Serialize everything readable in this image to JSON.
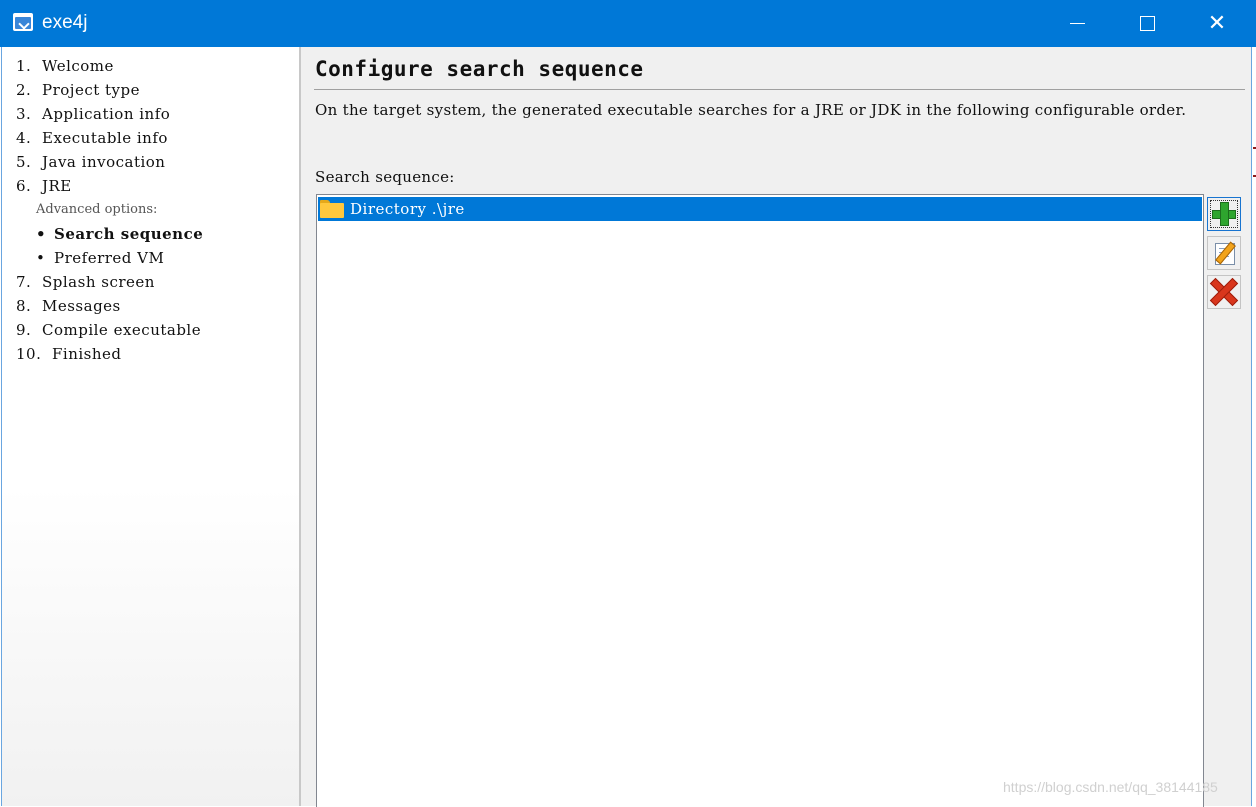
{
  "window": {
    "title": "exe4j"
  },
  "sidebar": {
    "steps": [
      {
        "number": "1.",
        "label": "Welcome"
      },
      {
        "number": "2.",
        "label": "Project type"
      },
      {
        "number": "3.",
        "label": "Application info"
      },
      {
        "number": "4.",
        "label": "Executable info"
      },
      {
        "number": "5.",
        "label": "Java invocation"
      },
      {
        "number": "6.",
        "label": "JRE"
      },
      {
        "number": "7.",
        "label": "Splash screen"
      },
      {
        "number": "8.",
        "label": "Messages"
      },
      {
        "number": "9.",
        "label": "Compile executable"
      },
      {
        "number": "10.",
        "label": "Finished"
      }
    ],
    "advanced_label": "Advanced options:",
    "sub_items": [
      {
        "bullet": "•",
        "label": "Search sequence",
        "active": true
      },
      {
        "bullet": "•",
        "label": "Preferred VM",
        "active": false
      }
    ]
  },
  "main": {
    "title": "Configure search sequence",
    "description": "On the target system, the generated executable searches for a JRE or JDK in the following configurable order.",
    "list_label": "Search sequence:",
    "items": [
      {
        "icon": "folder-icon",
        "label": "Directory .\\jre",
        "selected": true
      }
    ],
    "buttons": {
      "add": "add-icon",
      "edit": "edit-icon",
      "remove": "remove-icon"
    }
  },
  "watermark": "https://blog.csdn.net/qq_38144185",
  "colors": {
    "titlebar": "#0078d7",
    "selection": "#0078d7",
    "panel": "#f0f0f0"
  }
}
